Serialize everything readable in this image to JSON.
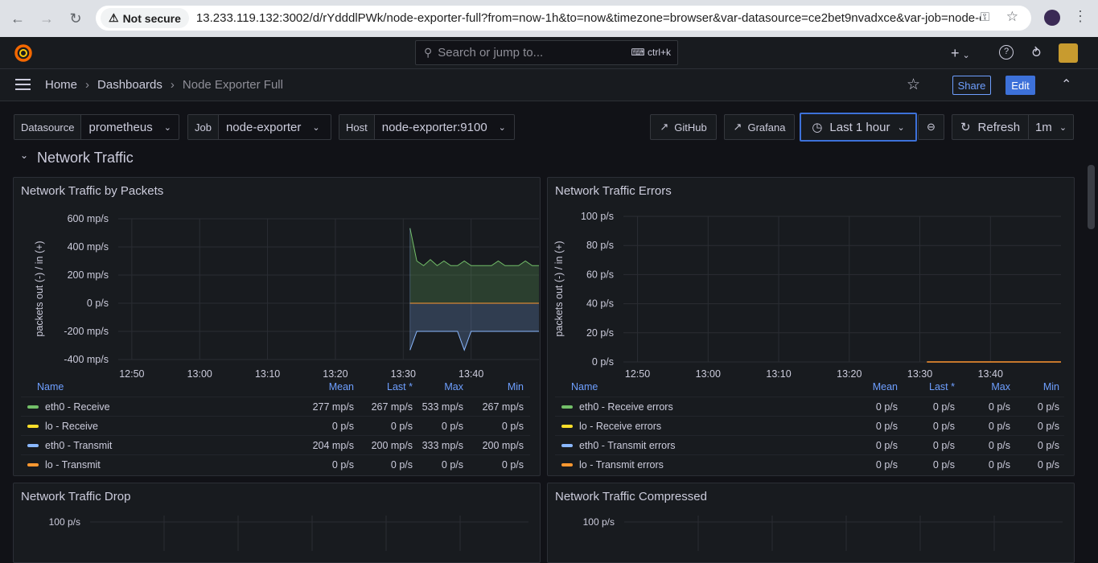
{
  "browser": {
    "not_secure": "Not secure",
    "url": "13.233.119.132:3002/d/rYdddlPWk/node-exporter-full?from=now-1h&to=now&timezone=browser&var-datasource=ce2bet9nvadxce&var-job=node-expo..."
  },
  "topbar": {
    "search_placeholder": "Search or jump to...",
    "shortcut": "ctrl+k"
  },
  "breadcrumbs": [
    "Home",
    "Dashboards",
    "Node Exporter Full"
  ],
  "toolbar": {
    "share": "Share",
    "edit": "Edit"
  },
  "variables": [
    {
      "label": "Datasource",
      "value": "prometheus"
    },
    {
      "label": "Job",
      "value": "node-exporter"
    },
    {
      "label": "Host",
      "value": "node-exporter:9100"
    }
  ],
  "links": {
    "github": "GitHub",
    "grafana": "Grafana"
  },
  "time": {
    "range": "Last 1 hour",
    "refresh": "Refresh",
    "interval": "1m"
  },
  "row_title": "Network Traffic",
  "colors": {
    "eth0_receive": "#73bf69",
    "lo_receive": "#fade2a",
    "eth0_transmit": "#8ab8ff",
    "lo_transmit": "#ff9830",
    "accent": "#3d71d9"
  },
  "panels": {
    "packets": {
      "title": "Network Traffic by Packets",
      "ylabel": "packets out (-) / in (+)",
      "legend_headers": [
        "Name",
        "Mean",
        "Last *",
        "Max",
        "Min"
      ],
      "legend": [
        {
          "name": "eth0 - Receive",
          "mean": "277 mp/s",
          "last": "267 mp/s",
          "max": "533 mp/s",
          "min": "267 mp/s"
        },
        {
          "name": "lo - Receive",
          "mean": "0 p/s",
          "last": "0 p/s",
          "max": "0 p/s",
          "min": "0 p/s"
        },
        {
          "name": "eth0 - Transmit",
          "mean": "204 mp/s",
          "last": "200 mp/s",
          "max": "333 mp/s",
          "min": "200 mp/s"
        },
        {
          "name": "lo - Transmit",
          "mean": "0 p/s",
          "last": "0 p/s",
          "max": "0 p/s",
          "min": "0 p/s"
        }
      ]
    },
    "errors": {
      "title": "Network Traffic Errors",
      "ylabel": "packets out (-) / in (+)",
      "legend_headers": [
        "Name",
        "Mean",
        "Last *",
        "Max",
        "Min"
      ],
      "legend": [
        {
          "name": "eth0 - Receive errors",
          "mean": "0 p/s",
          "last": "0 p/s",
          "max": "0 p/s",
          "min": "0 p/s"
        },
        {
          "name": "lo - Receive errors",
          "mean": "0 p/s",
          "last": "0 p/s",
          "max": "0 p/s",
          "min": "0 p/s"
        },
        {
          "name": "eth0 - Transmit errors",
          "mean": "0 p/s",
          "last": "0 p/s",
          "max": "0 p/s",
          "min": "0 p/s"
        },
        {
          "name": "lo - Transmit errors",
          "mean": "0 p/s",
          "last": "0 p/s",
          "max": "0 p/s",
          "min": "0 p/s"
        }
      ]
    },
    "drop": {
      "title": "Network Traffic Drop"
    },
    "compressed": {
      "title": "Network Traffic Compressed"
    }
  },
  "chart_data": [
    {
      "type": "area",
      "title": "Network Traffic by Packets",
      "ylabel": "packets out (-) / in (+)",
      "x_ticks": [
        "12:50",
        "13:00",
        "13:10",
        "13:20",
        "13:30",
        "13:40"
      ],
      "y_ticks": [
        "600 mp/s",
        "400 mp/s",
        "200 mp/s",
        "0 p/s",
        "-200 mp/s",
        "-400 mp/s"
      ],
      "ylim": [
        -0.4,
        0.6
      ],
      "x_minutes": [
        "13:31",
        "13:32",
        "13:33",
        "13:34",
        "13:35",
        "13:36",
        "13:37",
        "13:38",
        "13:39",
        "13:40",
        "13:41",
        "13:42",
        "13:43",
        "13:44",
        "13:45",
        "13:46",
        "13:47",
        "13:48",
        "13:49",
        "13:50"
      ],
      "series": [
        {
          "name": "eth0 - Receive",
          "values": [
            0.533,
            0.3,
            0.267,
            0.31,
            0.267,
            0.3,
            0.267,
            0.267,
            0.3,
            0.267,
            0.267,
            0.267,
            0.267,
            0.3,
            0.267,
            0.267,
            0.267,
            0.3,
            0.267,
            0.267
          ]
        },
        {
          "name": "lo - Receive",
          "values": [
            0,
            0,
            0,
            0,
            0,
            0,
            0,
            0,
            0,
            0,
            0,
            0,
            0,
            0,
            0,
            0,
            0,
            0,
            0,
            0
          ]
        },
        {
          "name": "eth0 - Transmit",
          "values": [
            -0.333,
            -0.2,
            -0.2,
            -0.2,
            -0.2,
            -0.2,
            -0.2,
            -0.2,
            -0.333,
            -0.2,
            -0.2,
            -0.2,
            -0.2,
            -0.2,
            -0.2,
            -0.2,
            -0.2,
            -0.2,
            -0.2,
            -0.2
          ]
        },
        {
          "name": "lo - Transmit",
          "values": [
            0,
            0,
            0,
            0,
            0,
            0,
            0,
            0,
            0,
            0,
            0,
            0,
            0,
            0,
            0,
            0,
            0,
            0,
            0,
            0
          ]
        }
      ]
    },
    {
      "type": "line",
      "title": "Network Traffic Errors",
      "ylabel": "packets out (-) / in (+)",
      "x_ticks": [
        "12:50",
        "13:00",
        "13:10",
        "13:20",
        "13:30",
        "13:40"
      ],
      "y_ticks": [
        "100 p/s",
        "80 p/s",
        "60 p/s",
        "40 p/s",
        "20 p/s",
        "0 p/s"
      ],
      "ylim": [
        0,
        100
      ],
      "series": [
        {
          "name": "lo - Transmit errors",
          "x_range": [
            "13:31",
            "13:50"
          ],
          "values": [
            0,
            0
          ]
        }
      ]
    }
  ]
}
